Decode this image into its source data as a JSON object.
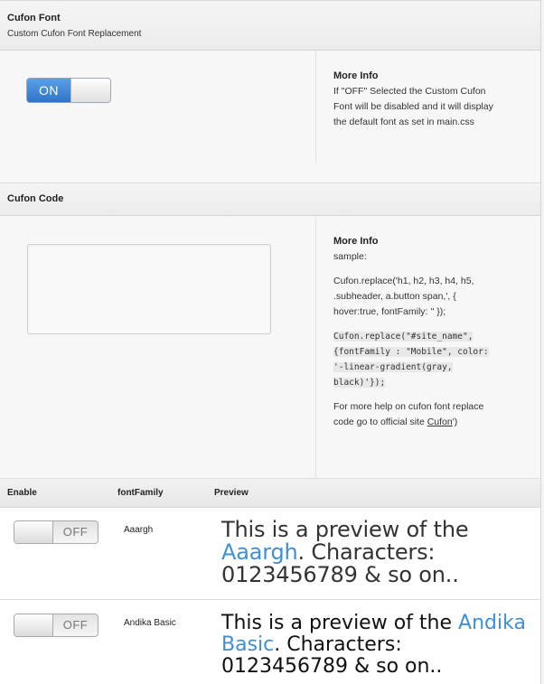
{
  "cufon_font": {
    "title": "Cufon Font",
    "subtitle": "Custom Cufon Font Replacement",
    "toggle_label": "ON",
    "info_title": "More Info",
    "info_text": "If \"OFF\" Selected the Custom Cufon Font will be disabled and it will display the default font as set in main.css"
  },
  "cufon_code": {
    "title": "Cufon Code",
    "textarea_value": "",
    "info_title": "More Info",
    "sample_label": "sample:",
    "sample_line": "Cufon.replace('h1, h2, h3, h4, h5, .subheader, a.button span,', { hover:true, fontFamily: '' });",
    "code_sample": "Cufon.replace(\"#site_name\", {fontFamily : \"Mobile\", color: '-linear-gradient(gray, black)'});",
    "help_text": "For more help on cufon font replace code go to official site",
    "help_link": "Cufon",
    "help_suffix": "')"
  },
  "table": {
    "col_enable": "Enable",
    "col_fontfamily": "fontFamily",
    "col_preview": "Preview",
    "rows": [
      {
        "toggle_label": "OFF",
        "font_family": "Aaargh",
        "preview_prefix": "This is a preview of the",
        "preview_font": "Aaargh",
        "preview_suffix": ". Characters: 0123456789 & so on.."
      },
      {
        "toggle_label": "OFF",
        "font_family": "Andika Basic",
        "preview_prefix": "This is a preview of the",
        "preview_font": "Andika Basic",
        "preview_suffix": ". Characters: 0123456789 & so on.."
      }
    ]
  },
  "colors": {
    "accent_blue": "#3f8fd6",
    "toggle_on_blue": "#2f74c8"
  }
}
